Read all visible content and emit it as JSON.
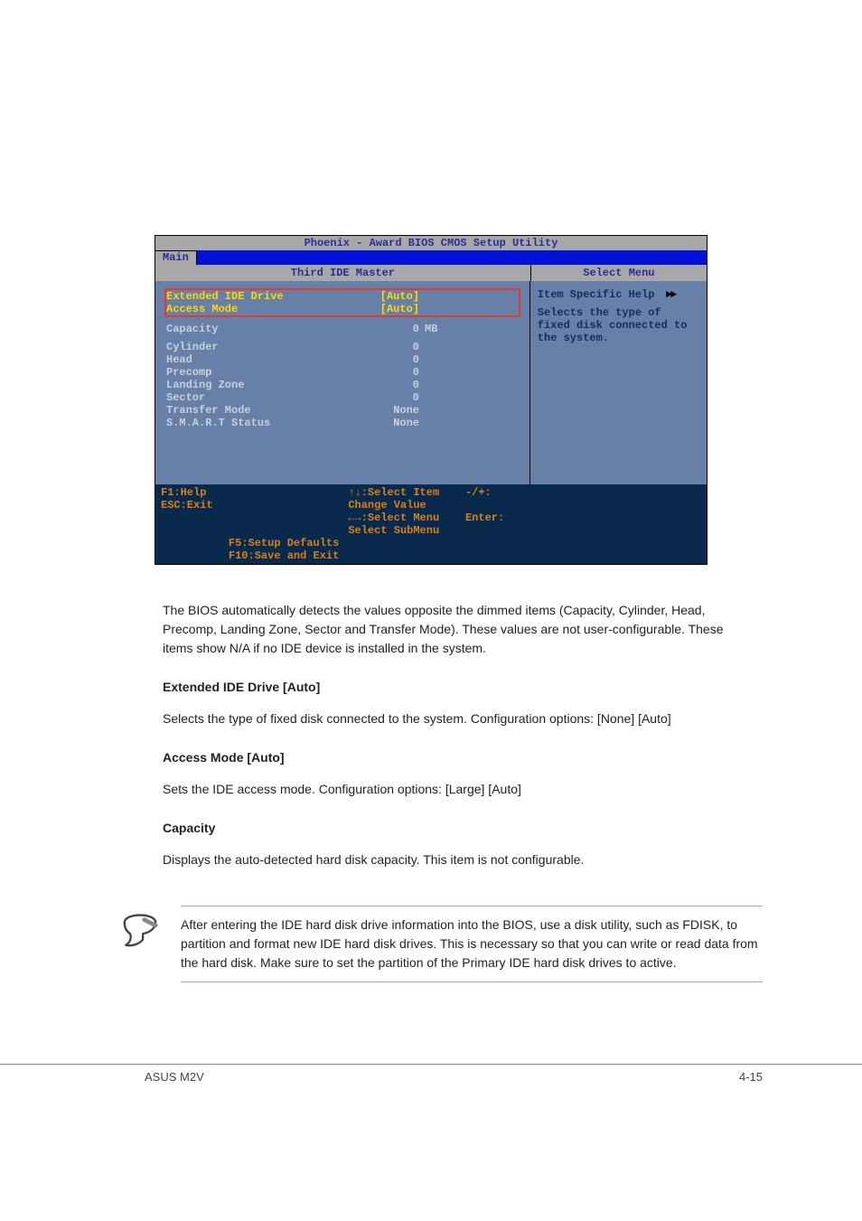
{
  "bios": {
    "title": "Phoenix - Award BIOS CMOS Setup Utility",
    "tab": "Main",
    "panel_title": "Third IDE Master",
    "select_menu_title": "Select Menu",
    "selected": [
      {
        "label": "Extended IDE Drive",
        "value": "[Auto]"
      },
      {
        "label": "Access Mode",
        "value": "[Auto]"
      }
    ],
    "capacity": {
      "label": "Capacity",
      "value": "0",
      "unit": "MB"
    },
    "readonly": [
      {
        "label": "Cylinder",
        "value": "0"
      },
      {
        "label": "Head",
        "value": "0"
      },
      {
        "label": "Precomp",
        "value": "0"
      },
      {
        "label": "Landing Zone",
        "value": "0"
      },
      {
        "label": "Sector",
        "value": "0"
      },
      {
        "label": "Transfer Mode",
        "value": "None"
      },
      {
        "label": "S.M.A.R.T Status",
        "value": "None"
      }
    ],
    "help": {
      "title": "Item Specific Help",
      "body": "Selects the type of fixed disk connected to the system."
    },
    "footer": {
      "l1": "F1:Help",
      "l2": "ESC:Exit",
      "m1a": "↑↓:Select Item",
      "m1b": "-/+: Change Value",
      "m2a": "←→:Select Menu",
      "m2b": "Enter: Select SubMenu",
      "r1": "F5:Setup Defaults",
      "r2": "F10:Save and Exit"
    }
  },
  "body_text": {
    "p1": "The BIOS automatically detects the values opposite the dimmed items (Capacity, Cylinder, Head, Precomp, Landing Zone, Sector and Transfer Mode). These values are not user-configurable. These items show N/A if no IDE device is installed in the system.",
    "h1": "Extended IDE Drive [Auto]",
    "p2": "Selects the type of fixed disk connected to the system. Configuration options: [None] [Auto]",
    "h2": "Access Mode [Auto]",
    "p3": "Sets the IDE access mode. Configuration options: [Large] [Auto]",
    "h3": "Capacity",
    "p4": "Displays the auto-detected hard disk capacity. This item is not configurable."
  },
  "note": "After entering the IDE hard disk drive information into the BIOS, use a disk utility, such as FDISK, to partition and format new IDE hard disk drives. This is necessary so that you can write or read data from the hard disk. Make sure to set the partition of the Primary IDE hard disk drives to active.",
  "footer": {
    "left": "ASUS M2V",
    "right": "4-15"
  }
}
